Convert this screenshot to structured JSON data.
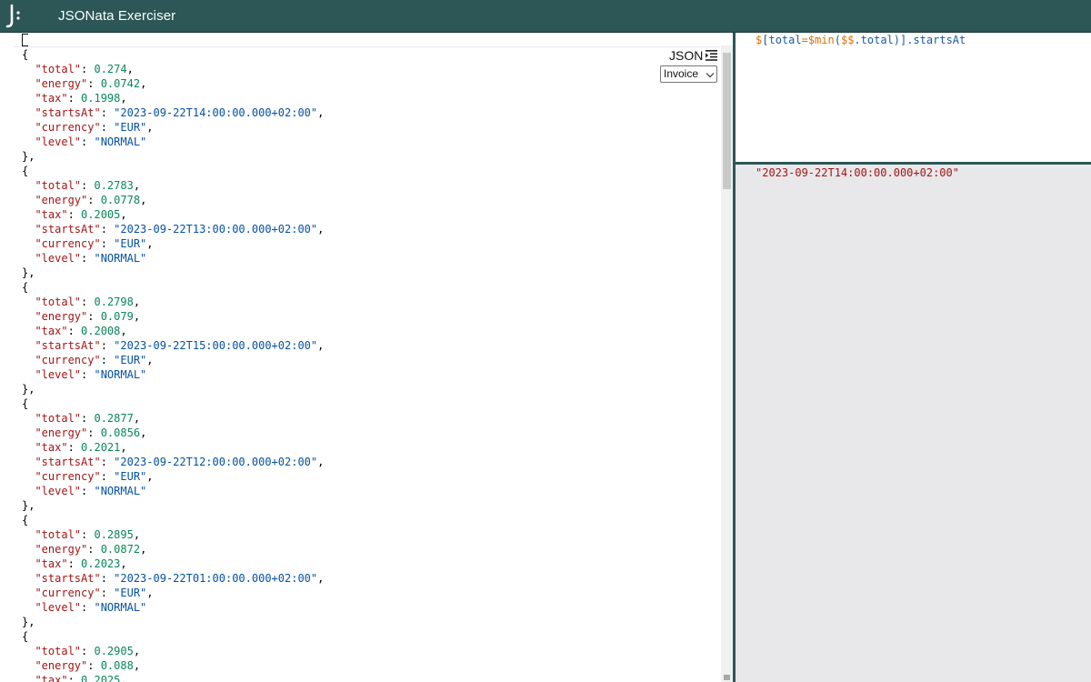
{
  "app": {
    "title": "JSONata Exerciser"
  },
  "input": {
    "format_label": "JSON",
    "sample_select": {
      "selected": "Invoice"
    },
    "open_bracket": "[",
    "lines": [
      [
        {
          "t": "p",
          "v": "{"
        }
      ],
      [
        {
          "t": "p",
          "v": "  "
        },
        {
          "t": "k",
          "v": "\"total\""
        },
        {
          "t": "p",
          "v": ": "
        },
        {
          "t": "n",
          "v": "0.274"
        },
        {
          "t": "p",
          "v": ","
        }
      ],
      [
        {
          "t": "p",
          "v": "  "
        },
        {
          "t": "k",
          "v": "\"energy\""
        },
        {
          "t": "p",
          "v": ": "
        },
        {
          "t": "n",
          "v": "0.0742"
        },
        {
          "t": "p",
          "v": ","
        }
      ],
      [
        {
          "t": "p",
          "v": "  "
        },
        {
          "t": "k",
          "v": "\"tax\""
        },
        {
          "t": "p",
          "v": ": "
        },
        {
          "t": "n",
          "v": "0.1998"
        },
        {
          "t": "p",
          "v": ","
        }
      ],
      [
        {
          "t": "p",
          "v": "  "
        },
        {
          "t": "k",
          "v": "\"startsAt\""
        },
        {
          "t": "p",
          "v": ": "
        },
        {
          "t": "s",
          "v": "\"2023-09-22T14:00:00.000+02:00\""
        },
        {
          "t": "p",
          "v": ","
        }
      ],
      [
        {
          "t": "p",
          "v": "  "
        },
        {
          "t": "k",
          "v": "\"currency\""
        },
        {
          "t": "p",
          "v": ": "
        },
        {
          "t": "s",
          "v": "\"EUR\""
        },
        {
          "t": "p",
          "v": ","
        }
      ],
      [
        {
          "t": "p",
          "v": "  "
        },
        {
          "t": "k",
          "v": "\"level\""
        },
        {
          "t": "p",
          "v": ": "
        },
        {
          "t": "s",
          "v": "\"NORMAL\""
        }
      ],
      [
        {
          "t": "p",
          "v": "},"
        }
      ],
      [
        {
          "t": "p",
          "v": "{"
        }
      ],
      [
        {
          "t": "p",
          "v": "  "
        },
        {
          "t": "k",
          "v": "\"total\""
        },
        {
          "t": "p",
          "v": ": "
        },
        {
          "t": "n",
          "v": "0.2783"
        },
        {
          "t": "p",
          "v": ","
        }
      ],
      [
        {
          "t": "p",
          "v": "  "
        },
        {
          "t": "k",
          "v": "\"energy\""
        },
        {
          "t": "p",
          "v": ": "
        },
        {
          "t": "n",
          "v": "0.0778"
        },
        {
          "t": "p",
          "v": ","
        }
      ],
      [
        {
          "t": "p",
          "v": "  "
        },
        {
          "t": "k",
          "v": "\"tax\""
        },
        {
          "t": "p",
          "v": ": "
        },
        {
          "t": "n",
          "v": "0.2005"
        },
        {
          "t": "p",
          "v": ","
        }
      ],
      [
        {
          "t": "p",
          "v": "  "
        },
        {
          "t": "k",
          "v": "\"startsAt\""
        },
        {
          "t": "p",
          "v": ": "
        },
        {
          "t": "s",
          "v": "\"2023-09-22T13:00:00.000+02:00\""
        },
        {
          "t": "p",
          "v": ","
        }
      ],
      [
        {
          "t": "p",
          "v": "  "
        },
        {
          "t": "k",
          "v": "\"currency\""
        },
        {
          "t": "p",
          "v": ": "
        },
        {
          "t": "s",
          "v": "\"EUR\""
        },
        {
          "t": "p",
          "v": ","
        }
      ],
      [
        {
          "t": "p",
          "v": "  "
        },
        {
          "t": "k",
          "v": "\"level\""
        },
        {
          "t": "p",
          "v": ": "
        },
        {
          "t": "s",
          "v": "\"NORMAL\""
        }
      ],
      [
        {
          "t": "p",
          "v": "},"
        }
      ],
      [
        {
          "t": "p",
          "v": "{"
        }
      ],
      [
        {
          "t": "p",
          "v": "  "
        },
        {
          "t": "k",
          "v": "\"total\""
        },
        {
          "t": "p",
          "v": ": "
        },
        {
          "t": "n",
          "v": "0.2798"
        },
        {
          "t": "p",
          "v": ","
        }
      ],
      [
        {
          "t": "p",
          "v": "  "
        },
        {
          "t": "k",
          "v": "\"energy\""
        },
        {
          "t": "p",
          "v": ": "
        },
        {
          "t": "n",
          "v": "0.079"
        },
        {
          "t": "p",
          "v": ","
        }
      ],
      [
        {
          "t": "p",
          "v": "  "
        },
        {
          "t": "k",
          "v": "\"tax\""
        },
        {
          "t": "p",
          "v": ": "
        },
        {
          "t": "n",
          "v": "0.2008"
        },
        {
          "t": "p",
          "v": ","
        }
      ],
      [
        {
          "t": "p",
          "v": "  "
        },
        {
          "t": "k",
          "v": "\"startsAt\""
        },
        {
          "t": "p",
          "v": ": "
        },
        {
          "t": "s",
          "v": "\"2023-09-22T15:00:00.000+02:00\""
        },
        {
          "t": "p",
          "v": ","
        }
      ],
      [
        {
          "t": "p",
          "v": "  "
        },
        {
          "t": "k",
          "v": "\"currency\""
        },
        {
          "t": "p",
          "v": ": "
        },
        {
          "t": "s",
          "v": "\"EUR\""
        },
        {
          "t": "p",
          "v": ","
        }
      ],
      [
        {
          "t": "p",
          "v": "  "
        },
        {
          "t": "k",
          "v": "\"level\""
        },
        {
          "t": "p",
          "v": ": "
        },
        {
          "t": "s",
          "v": "\"NORMAL\""
        }
      ],
      [
        {
          "t": "p",
          "v": "},"
        }
      ],
      [
        {
          "t": "p",
          "v": "{"
        }
      ],
      [
        {
          "t": "p",
          "v": "  "
        },
        {
          "t": "k",
          "v": "\"total\""
        },
        {
          "t": "p",
          "v": ": "
        },
        {
          "t": "n",
          "v": "0.2877"
        },
        {
          "t": "p",
          "v": ","
        }
      ],
      [
        {
          "t": "p",
          "v": "  "
        },
        {
          "t": "k",
          "v": "\"energy\""
        },
        {
          "t": "p",
          "v": ": "
        },
        {
          "t": "n",
          "v": "0.0856"
        },
        {
          "t": "p",
          "v": ","
        }
      ],
      [
        {
          "t": "p",
          "v": "  "
        },
        {
          "t": "k",
          "v": "\"tax\""
        },
        {
          "t": "p",
          "v": ": "
        },
        {
          "t": "n",
          "v": "0.2021"
        },
        {
          "t": "p",
          "v": ","
        }
      ],
      [
        {
          "t": "p",
          "v": "  "
        },
        {
          "t": "k",
          "v": "\"startsAt\""
        },
        {
          "t": "p",
          "v": ": "
        },
        {
          "t": "s",
          "v": "\"2023-09-22T12:00:00.000+02:00\""
        },
        {
          "t": "p",
          "v": ","
        }
      ],
      [
        {
          "t": "p",
          "v": "  "
        },
        {
          "t": "k",
          "v": "\"currency\""
        },
        {
          "t": "p",
          "v": ": "
        },
        {
          "t": "s",
          "v": "\"EUR\""
        },
        {
          "t": "p",
          "v": ","
        }
      ],
      [
        {
          "t": "p",
          "v": "  "
        },
        {
          "t": "k",
          "v": "\"level\""
        },
        {
          "t": "p",
          "v": ": "
        },
        {
          "t": "s",
          "v": "\"NORMAL\""
        }
      ],
      [
        {
          "t": "p",
          "v": "},"
        }
      ],
      [
        {
          "t": "p",
          "v": "{"
        }
      ],
      [
        {
          "t": "p",
          "v": "  "
        },
        {
          "t": "k",
          "v": "\"total\""
        },
        {
          "t": "p",
          "v": ": "
        },
        {
          "t": "n",
          "v": "0.2895"
        },
        {
          "t": "p",
          "v": ","
        }
      ],
      [
        {
          "t": "p",
          "v": "  "
        },
        {
          "t": "k",
          "v": "\"energy\""
        },
        {
          "t": "p",
          "v": ": "
        },
        {
          "t": "n",
          "v": "0.0872"
        },
        {
          "t": "p",
          "v": ","
        }
      ],
      [
        {
          "t": "p",
          "v": "  "
        },
        {
          "t": "k",
          "v": "\"tax\""
        },
        {
          "t": "p",
          "v": ": "
        },
        {
          "t": "n",
          "v": "0.2023"
        },
        {
          "t": "p",
          "v": ","
        }
      ],
      [
        {
          "t": "p",
          "v": "  "
        },
        {
          "t": "k",
          "v": "\"startsAt\""
        },
        {
          "t": "p",
          "v": ": "
        },
        {
          "t": "s",
          "v": "\"2023-09-22T01:00:00.000+02:00\""
        },
        {
          "t": "p",
          "v": ","
        }
      ],
      [
        {
          "t": "p",
          "v": "  "
        },
        {
          "t": "k",
          "v": "\"currency\""
        },
        {
          "t": "p",
          "v": ": "
        },
        {
          "t": "s",
          "v": "\"EUR\""
        },
        {
          "t": "p",
          "v": ","
        }
      ],
      [
        {
          "t": "p",
          "v": "  "
        },
        {
          "t": "k",
          "v": "\"level\""
        },
        {
          "t": "p",
          "v": ": "
        },
        {
          "t": "s",
          "v": "\"NORMAL\""
        }
      ],
      [
        {
          "t": "p",
          "v": "},"
        }
      ],
      [
        {
          "t": "p",
          "v": "{"
        }
      ],
      [
        {
          "t": "p",
          "v": "  "
        },
        {
          "t": "k",
          "v": "\"total\""
        },
        {
          "t": "p",
          "v": ": "
        },
        {
          "t": "n",
          "v": "0.2905"
        },
        {
          "t": "p",
          "v": ","
        }
      ],
      [
        {
          "t": "p",
          "v": "  "
        },
        {
          "t": "k",
          "v": "\"energy\""
        },
        {
          "t": "p",
          "v": ": "
        },
        {
          "t": "n",
          "v": "0.088"
        },
        {
          "t": "p",
          "v": ","
        }
      ],
      [
        {
          "t": "p",
          "v": "  "
        },
        {
          "t": "k",
          "v": "\"tax\""
        },
        {
          "t": "p",
          "v": ": "
        },
        {
          "t": "n",
          "v": "0.2025"
        },
        {
          "t": "p",
          "v": ","
        }
      ]
    ]
  },
  "expression": {
    "tokens": [
      {
        "t": "sym",
        "v": "$"
      },
      {
        "t": "br",
        "v": "["
      },
      {
        "t": "txt",
        "v": "total"
      },
      {
        "t": "sym",
        "v": "="
      },
      {
        "t": "sym",
        "v": "$min"
      },
      {
        "t": "br",
        "v": "("
      },
      {
        "t": "sym",
        "v": "$$"
      },
      {
        "t": "txt",
        "v": ".total"
      },
      {
        "t": "br",
        "v": ")]"
      },
      {
        "t": "txt",
        "v": ".startsAt"
      }
    ]
  },
  "result": {
    "text": "\"2023-09-22T14:00:00.000+02:00\""
  },
  "colors": {
    "header_bg": "#2d5656",
    "json_key": "#a31515",
    "json_number": "#098658",
    "json_string": "#0451a5",
    "expr_symbol": "#e06c00",
    "expr_text": "#1b5aa5",
    "result_text": "#a31515",
    "result_bg": "#e8e8ea"
  }
}
